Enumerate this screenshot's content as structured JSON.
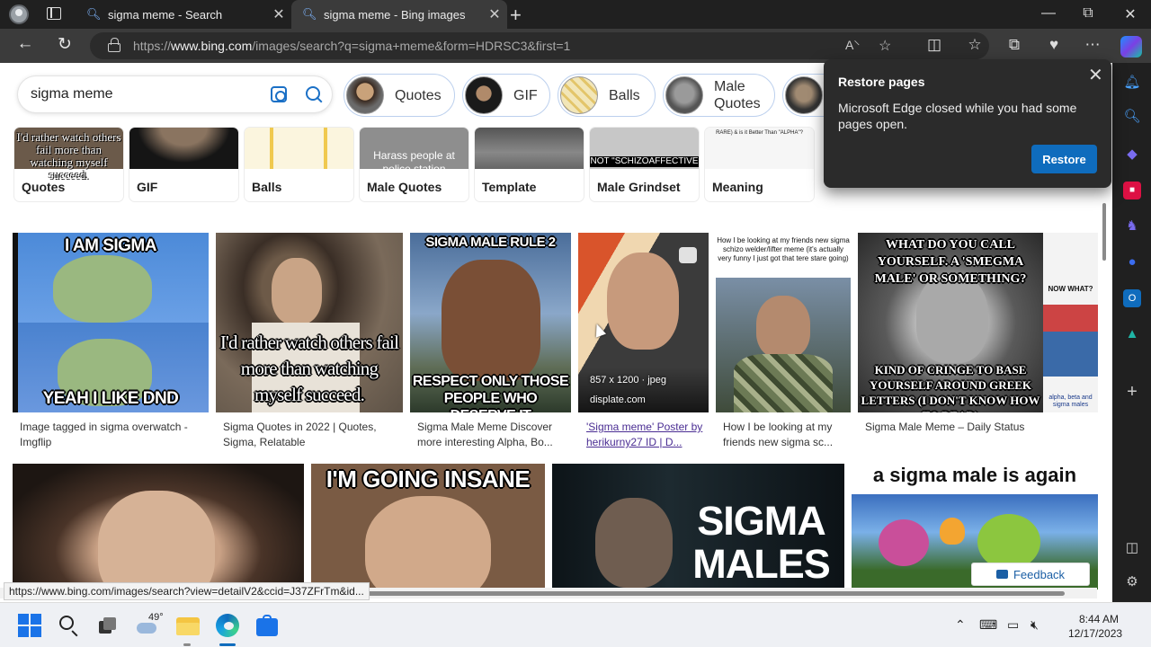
{
  "browser": {
    "tabs": [
      {
        "title": "sigma meme - Search",
        "active": false
      },
      {
        "title": "sigma meme - Bing images",
        "active": true
      }
    ],
    "new_tab": "+",
    "url": {
      "prefix": "https://",
      "host": "www.bing.com",
      "path": "/images/search?q=sigma+meme&form=HDRSC3&first=1"
    },
    "icons": [
      "back-icon",
      "refresh-icon",
      "read-aloud-icon",
      "favorite-icon",
      "split-screen-icon",
      "favorites-icon",
      "collections-icon",
      "performance-icon",
      "more-icon"
    ]
  },
  "search": {
    "query": "sigma meme"
  },
  "related_pills": [
    {
      "label": "Quotes"
    },
    {
      "label": "GIF"
    },
    {
      "label": "Balls"
    },
    {
      "label": "Male\nQuotes"
    }
  ],
  "categories": [
    {
      "label": "Quotes",
      "thumb_text": "I'd rather watch others fail more than watching myself succeed."
    },
    {
      "label": "GIF"
    },
    {
      "label": "Balls"
    },
    {
      "label": "Male Quotes",
      "thumb_text": "Harass people at police station"
    },
    {
      "label": "Template"
    },
    {
      "label": "Male Grindset",
      "thumb_text": "NOT \"SCHIZOAFFECTIVE"
    },
    {
      "label": "Meaning",
      "thumb_text": "RARE) & is it Better Than \"ALPHA\"?"
    }
  ],
  "results_row1": [
    {
      "caption": "Image tagged in sigma overwatch - Imgflip",
      "top_text": "I AM SIGMA",
      "bottom_text": "YEAH I LIKE DND"
    },
    {
      "caption": "Sigma Quotes in 2022 | Quotes, Sigma, Relatable",
      "overlay_text": "I'd rather watch others fail more than watching myself succeed."
    },
    {
      "caption": "Sigma Male Meme Discover more interesting Alpha, Bo...",
      "top_text": "SIGMA MALE RULE 2",
      "bottom_text": "RESPECT ONLY THOSE PEOPLE WHO DESERVE IT"
    },
    {
      "caption": "'Sigma meme' Poster by herikurny27 ID | D...",
      "dims": "857 x 1200 · jpeg",
      "source": "displate.com"
    },
    {
      "caption": "How I be looking at my friends new sigma sc...",
      "top_text": "How I be looking at my friends new sigma schizo welder/lifter meme (it's actually very funny I just got that tere stare going)"
    },
    {
      "caption": "Sigma Male Meme – Daily Status",
      "top_text": "WHAT DO YOU CALL YOURSELF. A 'SMEGMA MALE' OR SOMETHING?",
      "bottom_text": "KIND OF CRINGE TO BASE YOURSELF AROUND GREEK LETTERS (I DON'T KNOW HOW TO READ)",
      "side_top": "NOW WHAT?",
      "side_bottom": "alpha, beta and sigma males"
    }
  ],
  "results_row2": [
    {
      "overlay_text": ""
    },
    {
      "top_text": "I'M GOING INSANE"
    },
    {
      "overlay_text": "SIGMA\nMALES"
    },
    {
      "top_text": "a sigma male is again"
    }
  ],
  "feedback": {
    "label": "Feedback"
  },
  "status_url": "https://www.bing.com/images/search?view=detailV2&ccid=J37ZFrTm&id...",
  "restore_popup": {
    "title": "Restore pages",
    "message": "Microsoft Edge closed while you had some pages open.",
    "button": "Restore"
  },
  "taskbar": {
    "weather_temp": "49°",
    "time": "8:44 AM",
    "date": "12/17/2023"
  },
  "colors": {
    "accent": "#0f6cbd",
    "bing_blue": "#1b70c6",
    "link_visited": "#4a2d93"
  }
}
